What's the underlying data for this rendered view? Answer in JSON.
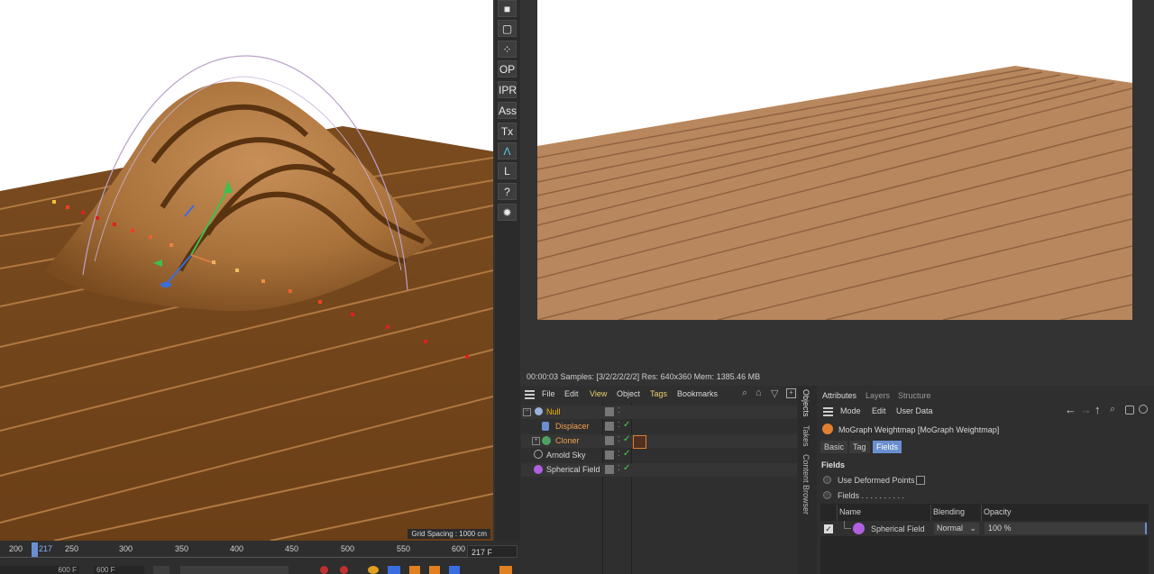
{
  "viewport": {
    "grid_spacing": "Grid Spacing : 1000 cm"
  },
  "timeline": {
    "ticks": [
      "200",
      "217",
      "250",
      "300",
      "350",
      "400",
      "450",
      "500",
      "550",
      "600"
    ],
    "current_frame": "217 F",
    "min_field": "600 F",
    "max_field": "600 F"
  },
  "side_toolbar": [
    "OP",
    "IPR",
    "Ass",
    "Tx",
    "L",
    "?"
  ],
  "render": {
    "status": "00:00:03  Samples: [3/2/2/2/2/2]  Res: 640x360  Mem: 1385.46 MB"
  },
  "objects": {
    "menu": [
      "File",
      "Edit",
      "View",
      "Object",
      "Tags",
      "Bookmarks"
    ],
    "rows": [
      {
        "name": "Null",
        "color": "#f0b400",
        "icon": "null-icon"
      },
      {
        "name": "Displacer",
        "color": "#f0a050",
        "icon": "displacer-icon"
      },
      {
        "name": "Cloner",
        "color": "#f0a050",
        "icon": "cloner-icon"
      },
      {
        "name": "Arnold Sky",
        "color": "#d6d6d6",
        "icon": "globe-icon"
      },
      {
        "name": "Spherical Field",
        "color": "#d6d6d6",
        "icon": "sphere-icon"
      }
    ]
  },
  "vertical_tabs": [
    "Objects",
    "Takes",
    "Content Browser"
  ],
  "attributes": {
    "tabs": [
      "Attributes",
      "Layers",
      "Structure"
    ],
    "menu": [
      "Mode",
      "Edit",
      "User Data"
    ],
    "object_title": "MoGraph Weightmap [MoGraph Weightmap]",
    "subtabs": [
      "Basic",
      "Tag",
      "Fields"
    ],
    "section": "Fields",
    "use_deformed_points": "Use Deformed Points",
    "fields_label": "Fields . . . . . . . . . .",
    "columns": [
      "Name",
      "Blending",
      "Opacity"
    ],
    "field_row": {
      "name": "Spherical Field",
      "blending": "Normal",
      "opacity": "100 %"
    }
  }
}
